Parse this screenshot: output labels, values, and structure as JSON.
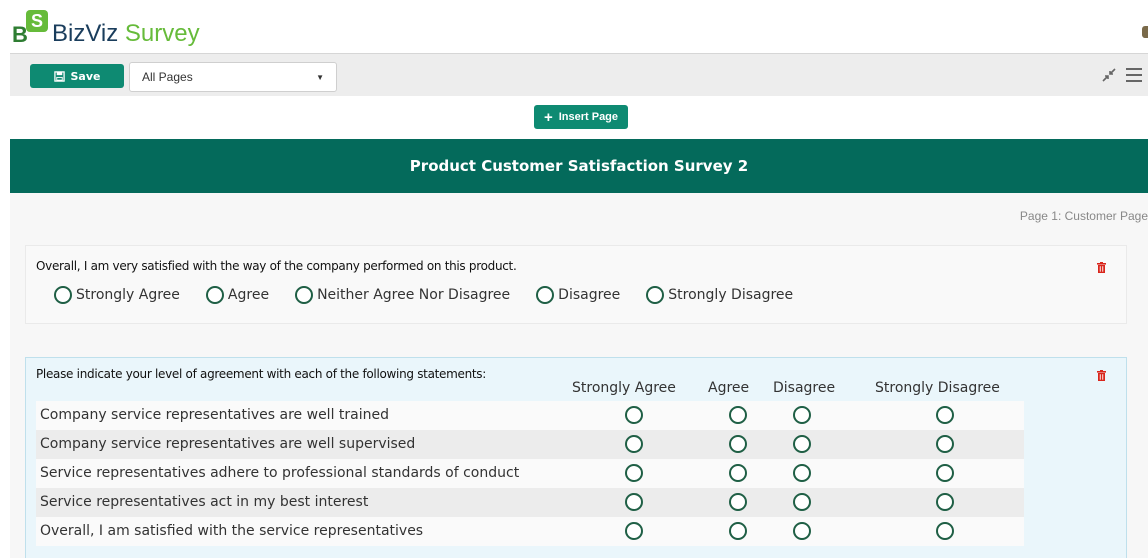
{
  "brand": {
    "part1": "BizViz",
    "part2": "Survey",
    "logo_big": "B",
    "logo_small": "S"
  },
  "toolbar": {
    "save_label": "Save",
    "page_select_value": "All Pages"
  },
  "insert_label": "Insert Page",
  "survey_title": "Product Customer Satisfaction Survey 2",
  "page_label": "Page 1:  Customer Page",
  "q1": {
    "text": "Overall, I am very satisfied with the way of the company performed on this product.",
    "options": [
      "Strongly Agree",
      "Agree",
      "Neither Agree Nor Disagree",
      "Disagree",
      "Strongly Disagree"
    ]
  },
  "q2": {
    "text": "Please indicate your level of agreement with each of the following statements:",
    "columns": [
      "Strongly Agree",
      "Agree",
      "Disagree",
      "Strongly Disagree"
    ],
    "rows": [
      "Company service representatives are well trained",
      "Company service representatives are well supervised",
      "Service representatives adhere to professional standards of conduct",
      "Service representatives act in my best interest",
      "Overall, I am satisfied with the service representatives"
    ]
  },
  "colors": {
    "accent": "#0e8a72",
    "banner": "#046a5b",
    "radio": "#1f5f45"
  }
}
